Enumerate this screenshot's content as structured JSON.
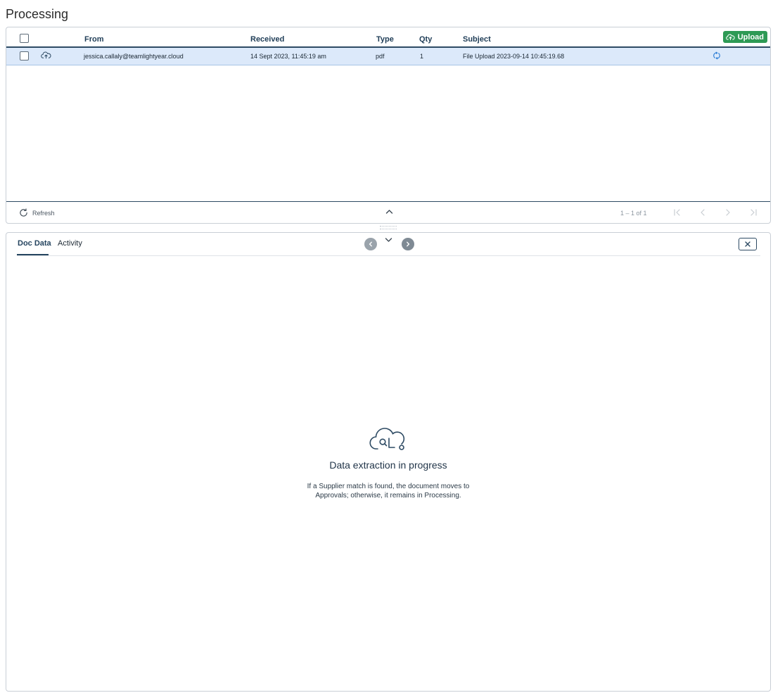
{
  "page": {
    "title": "Processing"
  },
  "grid": {
    "columns": {
      "from": "From",
      "received": "Received",
      "type": "Type",
      "qty": "Qty",
      "subject": "Subject"
    },
    "upload_label": "Upload",
    "rows": [
      {
        "from": "jessica.callaly@teamlightyear.cloud",
        "received": "14 Sept 2023, 11:45:19 am",
        "type": "pdf",
        "qty": "1",
        "subject": "File Upload 2023-09-14 10:45:19.68",
        "source_icon": "cloud-upload-icon",
        "status_icon": "sync-icon"
      }
    ],
    "footer": {
      "refresh_label": "Refresh",
      "page_info": "1 – 1 of 1"
    }
  },
  "detail": {
    "tabs": [
      {
        "label": "Doc Data",
        "active": true
      },
      {
        "label": "Activity",
        "active": false
      }
    ],
    "empty_state": {
      "icon": "cloud-processing-icon",
      "title": "Data extraction in progress",
      "text": "If a Supplier match is found, the document moves to Approvals; otherwise, it remains in Processing."
    }
  },
  "colors": {
    "accent": "#25445f",
    "upload_button": "#2e9a55",
    "selected_row": "#dce9fa",
    "link_icon": "#2f7fd6"
  }
}
